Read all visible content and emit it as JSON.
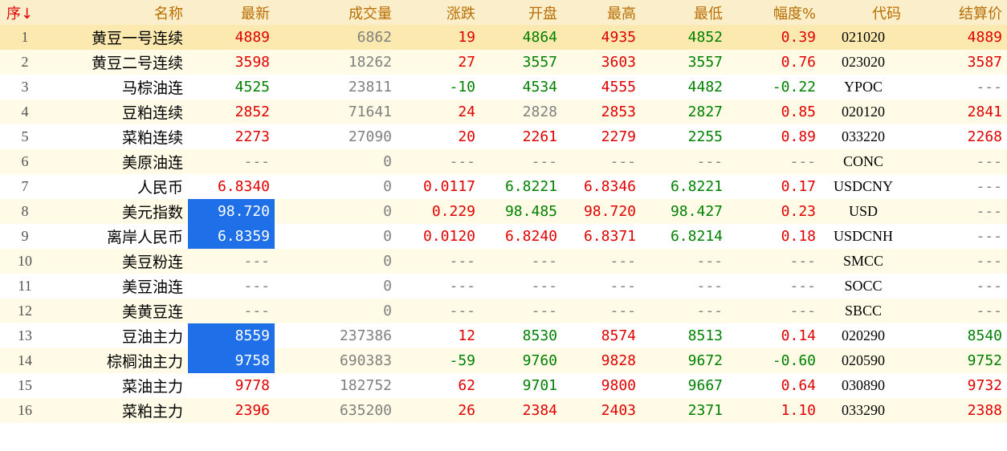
{
  "colors": {
    "up": "#E00000",
    "down": "#008000",
    "flat": "#808080",
    "header_text": "#B86D00",
    "highlight": "#1E6FE8",
    "header_bg": "#FBEFCB"
  },
  "headers": {
    "seq": "序↓",
    "name": "名称",
    "last": "最新",
    "volume": "成交量",
    "change": "涨跌",
    "open": "开盘",
    "high": "最高",
    "low": "最低",
    "pct": "幅度%",
    "code": "代码",
    "settle": "结算价"
  },
  "rows": [
    {
      "seq": "1",
      "name": "黄豆一号连续",
      "last": "4889",
      "volume": "6862",
      "change": "19",
      "open": "4864",
      "high": "4935",
      "low": "4852",
      "pct": "0.39",
      "code": "021020",
      "settle": "4889"
    },
    {
      "seq": "2",
      "name": "黄豆二号连续",
      "last": "3598",
      "volume": "18262",
      "change": "27",
      "open": "3557",
      "high": "3603",
      "low": "3557",
      "pct": "0.76",
      "code": "023020",
      "settle": "3587"
    },
    {
      "seq": "3",
      "name": "马棕油连",
      "last": "4525",
      "volume": "23811",
      "change": "-10",
      "open": "4534",
      "high": "4555",
      "low": "4482",
      "pct": "-0.22",
      "code": "YPOC",
      "settle": "---"
    },
    {
      "seq": "4",
      "name": "豆粕连续",
      "last": "2852",
      "volume": "71641",
      "change": "24",
      "open": "2828",
      "high": "2853",
      "low": "2827",
      "pct": "0.85",
      "code": "020120",
      "settle": "2841"
    },
    {
      "seq": "5",
      "name": "菜粕连续",
      "last": "2273",
      "volume": "27090",
      "change": "20",
      "open": "2261",
      "high": "2279",
      "low": "2255",
      "pct": "0.89",
      "code": "033220",
      "settle": "2268"
    },
    {
      "seq": "6",
      "name": "美原油连",
      "last": "---",
      "volume": "0",
      "change": "---",
      "open": "---",
      "high": "---",
      "low": "---",
      "pct": "---",
      "code": "CONC",
      "settle": "---"
    },
    {
      "seq": "7",
      "name": "人民币",
      "last": "6.8340",
      "volume": "0",
      "change": "0.0117",
      "open": "6.8221",
      "high": "6.8346",
      "low": "6.8221",
      "pct": "0.17",
      "code": "USDCNY",
      "settle": "---"
    },
    {
      "seq": "8",
      "name": "美元指数",
      "last": "98.720",
      "volume": "0",
      "change": "0.229",
      "open": "98.485",
      "high": "98.720",
      "low": "98.427",
      "pct": "0.23",
      "code": "USD",
      "settle": "---"
    },
    {
      "seq": "9",
      "name": "离岸人民币",
      "last": "6.8359",
      "volume": "0",
      "change": "0.0120",
      "open": "6.8240",
      "high": "6.8371",
      "low": "6.8214",
      "pct": "0.18",
      "code": "USDCNH",
      "settle": "---"
    },
    {
      "seq": "10",
      "name": "美豆粉连",
      "last": "---",
      "volume": "0",
      "change": "---",
      "open": "---",
      "high": "---",
      "low": "---",
      "pct": "---",
      "code": "SMCC",
      "settle": "---"
    },
    {
      "seq": "11",
      "name": "美豆油连",
      "last": "---",
      "volume": "0",
      "change": "---",
      "open": "---",
      "high": "---",
      "low": "---",
      "pct": "---",
      "code": "SOCC",
      "settle": "---"
    },
    {
      "seq": "12",
      "name": "美黄豆连",
      "last": "---",
      "volume": "0",
      "change": "---",
      "open": "---",
      "high": "---",
      "low": "---",
      "pct": "---",
      "code": "SBCC",
      "settle": "---"
    },
    {
      "seq": "13",
      "name": "豆油主力",
      "last": "8559",
      "volume": "237386",
      "change": "12",
      "open": "8530",
      "high": "8574",
      "low": "8513",
      "pct": "0.14",
      "code": "020290",
      "settle": "8540"
    },
    {
      "seq": "14",
      "name": "棕榈油主力",
      "last": "9758",
      "volume": "690383",
      "change": "-59",
      "open": "9760",
      "high": "9828",
      "low": "9672",
      "pct": "-0.60",
      "code": "020590",
      "settle": "9752"
    },
    {
      "seq": "15",
      "name": "菜油主力",
      "last": "9778",
      "volume": "182752",
      "change": "62",
      "open": "9701",
      "high": "9800",
      "low": "9667",
      "pct": "0.64",
      "code": "030890",
      "settle": "9732"
    },
    {
      "seq": "16",
      "name": "菜粕主力",
      "last": "2396",
      "volume": "635200",
      "change": "26",
      "open": "2384",
      "high": "2403",
      "low": "2371",
      "pct": "1.10",
      "code": "033290",
      "settle": "2388"
    }
  ]
}
